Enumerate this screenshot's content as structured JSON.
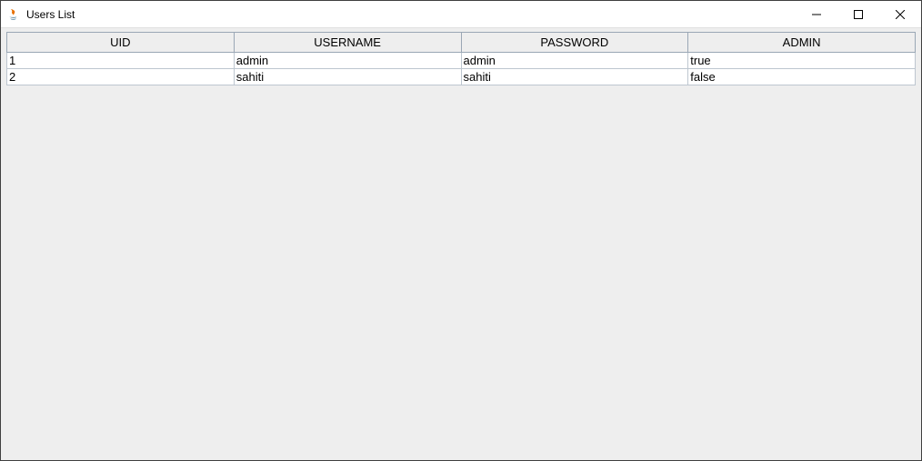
{
  "window": {
    "title": "Users List"
  },
  "table": {
    "headers": [
      "UID",
      "USERNAME",
      "PASSWORD",
      "ADMIN"
    ],
    "rows": [
      {
        "uid": "1",
        "username": "admin",
        "password": "admin",
        "admin": "true"
      },
      {
        "uid": "2",
        "username": "sahiti",
        "password": "sahiti",
        "admin": "false"
      }
    ]
  }
}
